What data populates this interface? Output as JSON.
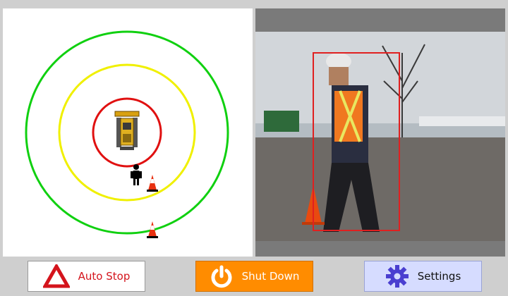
{
  "buttons": {
    "auto_stop": {
      "label": "Auto Stop",
      "icon": "warning-triangle-icon"
    },
    "shut_down": {
      "label": "Shut Down",
      "icon": "power-icon"
    },
    "settings": {
      "label": "Settings",
      "icon": "gear-icon"
    }
  },
  "radar": {
    "zones": [
      {
        "name": "danger",
        "color": "#e01010"
      },
      {
        "name": "warning",
        "color": "#f0f000"
      },
      {
        "name": "safe",
        "color": "#10d010"
      }
    ],
    "objects": [
      "dozer-icon",
      "person-icon",
      "traffic-cone-icon",
      "traffic-cone-icon"
    ]
  },
  "camera": {
    "detection_color": "#e02020"
  },
  "colors": {
    "shutdown_bg": "#ff8c00",
    "settings_bg": "#d6dcff",
    "autostop_fg": "#d4141c"
  }
}
